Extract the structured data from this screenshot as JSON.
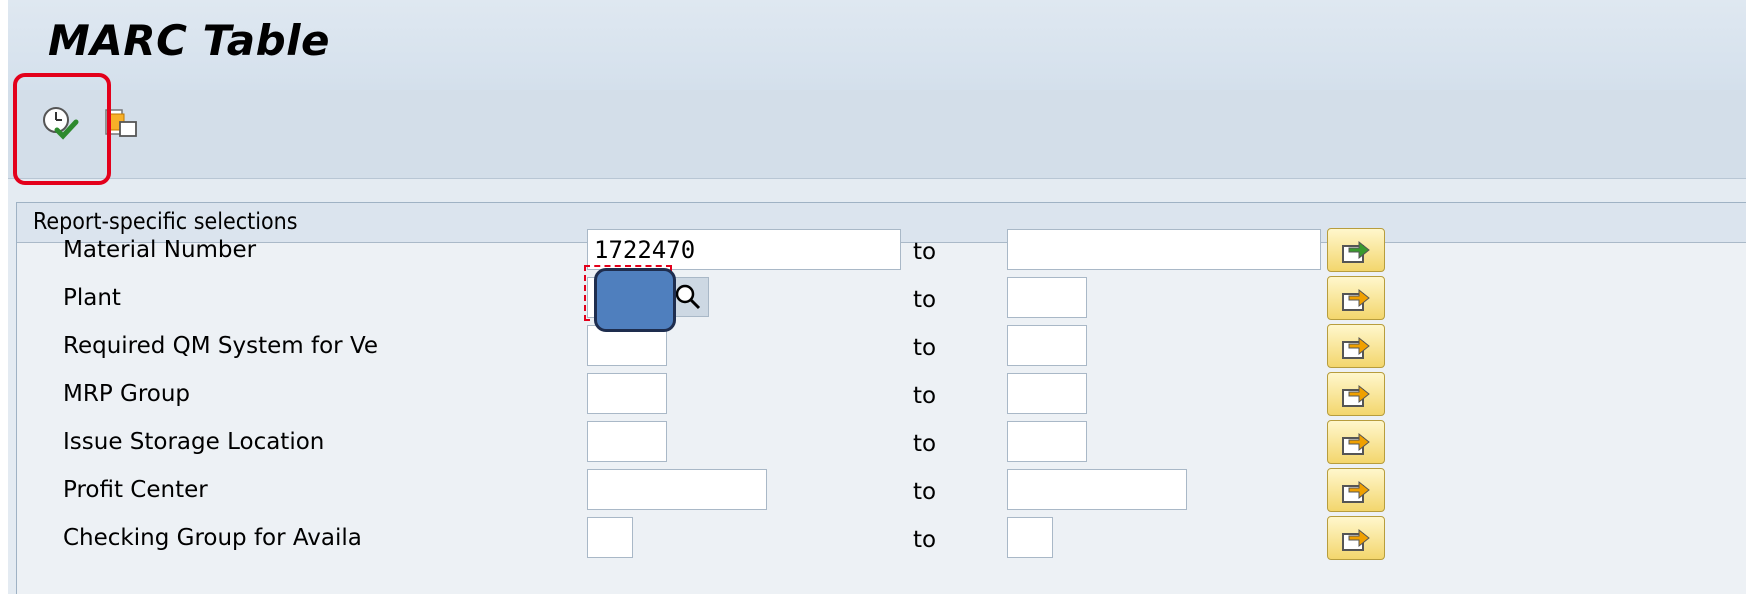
{
  "window": {
    "title": "MARC Table"
  },
  "toolbar": {
    "execute_icon": "execute-clock-check-icon",
    "variant_icon": "get-variant-icon",
    "highlight_color": "#e3001b"
  },
  "panel": {
    "header": "Report-specific selections",
    "rows": [
      {
        "label": "Material Number",
        "low": "1722470",
        "to": "to",
        "high": ""
      },
      {
        "label": "Plant",
        "low": "",
        "to": "to",
        "high": ""
      },
      {
        "label": "Required QM System for Ve",
        "low": "",
        "to": "to",
        "high": ""
      },
      {
        "label": "MRP Group",
        "low": "",
        "to": "to",
        "high": ""
      },
      {
        "label": "Issue Storage Location",
        "low": "",
        "to": "to",
        "high": ""
      },
      {
        "label": "Profit Center",
        "low": "",
        "to": "to",
        "high": ""
      },
      {
        "label": "Checking Group for Availa",
        "low": "",
        "to": "to",
        "high": ""
      }
    ]
  },
  "colors": {
    "focus_cover": "#4f7fbe",
    "multi_button": "#f3d66d",
    "multi_arrow": "#f0a000",
    "multi_arrow_active": "#3a9a2e"
  }
}
